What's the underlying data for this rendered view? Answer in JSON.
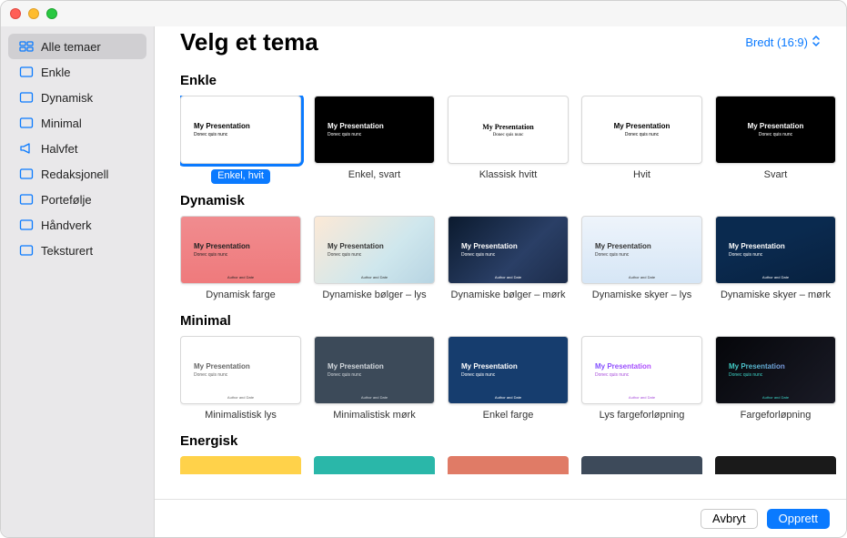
{
  "header": {
    "title": "Velg et tema",
    "aspect_label": "Bredt (16:9)"
  },
  "sidebar": {
    "items": [
      {
        "label": "Alle temaer",
        "icon": "grid"
      },
      {
        "label": "Enkle",
        "icon": "slide"
      },
      {
        "label": "Dynamisk",
        "icon": "slide"
      },
      {
        "label": "Minimal",
        "icon": "slide"
      },
      {
        "label": "Halvfet",
        "icon": "megaphone"
      },
      {
        "label": "Redaksjonell",
        "icon": "slide"
      },
      {
        "label": "Portefølje",
        "icon": "slide"
      },
      {
        "label": "Håndverk",
        "icon": "slide"
      },
      {
        "label": "Teksturert",
        "icon": "slide"
      }
    ],
    "selected_index": 0
  },
  "presentation_text": {
    "title": "My Presentation",
    "subtitle": "Donec quis nunc",
    "author": "Author and Date"
  },
  "sections": [
    {
      "title": "Enkle",
      "themes": [
        {
          "label": "Enkel, hvit",
          "bg": "#ffffff",
          "fg": "#000000",
          "align": "left",
          "selected": true
        },
        {
          "label": "Enkel, svart",
          "bg": "#000000",
          "fg": "#ffffff",
          "align": "left"
        },
        {
          "label": "Klassisk hvitt",
          "bg": "#ffffff",
          "fg": "#000000",
          "align": "center",
          "serif": true
        },
        {
          "label": "Hvit",
          "bg": "#ffffff",
          "fg": "#000000",
          "align": "center"
        },
        {
          "label": "Svart",
          "bg": "#000000",
          "fg": "#ffffff",
          "align": "center"
        }
      ]
    },
    {
      "title": "Dynamisk",
      "themes": [
        {
          "label": "Dynamisk farge",
          "bg": "linear-gradient(180deg,#f08c8f,#ef7a7c)",
          "fg": "#222",
          "align": "left",
          "author_center": true
        },
        {
          "label": "Dynamiske bølger – lys",
          "bg": "linear-gradient(135deg,#fce9d6,#cfe7ed 60%,#b7d4e2)",
          "fg": "#333",
          "align": "left",
          "author_center": true
        },
        {
          "label": "Dynamiske bølger – mørk",
          "bg": "linear-gradient(135deg,#0b1a2e,#2a3f66 60%,#1c2c4a)",
          "fg": "#fff",
          "align": "left",
          "author_center": true
        },
        {
          "label": "Dynamiske skyer – lys",
          "bg": "linear-gradient(180deg,#eef4fb,#d6e6f6)",
          "fg": "#333",
          "align": "left",
          "author_center": true
        },
        {
          "label": "Dynamiske skyer – mørk",
          "bg": "linear-gradient(160deg,#0a2a4f,#0a2a4f 40%,#08213f)",
          "fg": "#fff",
          "align": "left",
          "author_center": true
        },
        {
          "label": "",
          "bg": "linear-gradient(180deg,#ffe8ec,#e5f7ec,#e5ecff)",
          "fg": "#333",
          "align": "left",
          "partial": true
        }
      ]
    },
    {
      "title": "Minimal",
      "themes": [
        {
          "label": "Minimalistisk lys",
          "bg": "#ffffff",
          "fg": "#666",
          "align": "left",
          "author_center": true
        },
        {
          "label": "Minimalistisk mørk",
          "bg": "#3c4a59",
          "fg": "#d4d9de",
          "align": "left",
          "author_center": true
        },
        {
          "label": "Enkel farge",
          "bg": "#163d6e",
          "fg": "#fff",
          "align": "left",
          "author_center": true
        },
        {
          "label": "Lys fargeforløpning",
          "bg": "#ffffff",
          "fg": "linear-gradient(90deg,#7c4dff,#e040fb)",
          "fg_solid": "#a84ddb",
          "align": "left",
          "author_center": true
        },
        {
          "label": "Fargeforløpning",
          "bg": "linear-gradient(135deg,#05060a,#1a1b26)",
          "fg_solid": "#3dd5c8",
          "grad_title": true,
          "align": "left",
          "author_center": true
        },
        {
          "label": "",
          "bg": "#ffffff",
          "fg": "#333",
          "align": "left",
          "partial": true
        }
      ]
    }
  ],
  "energisk": {
    "title": "Energisk",
    "colors": [
      "#ffd24a",
      "#2ab7a9",
      "#e07b66",
      "#3d4a5a",
      "#1a1a1a"
    ]
  },
  "footer": {
    "cancel": "Avbryt",
    "create": "Opprett"
  }
}
